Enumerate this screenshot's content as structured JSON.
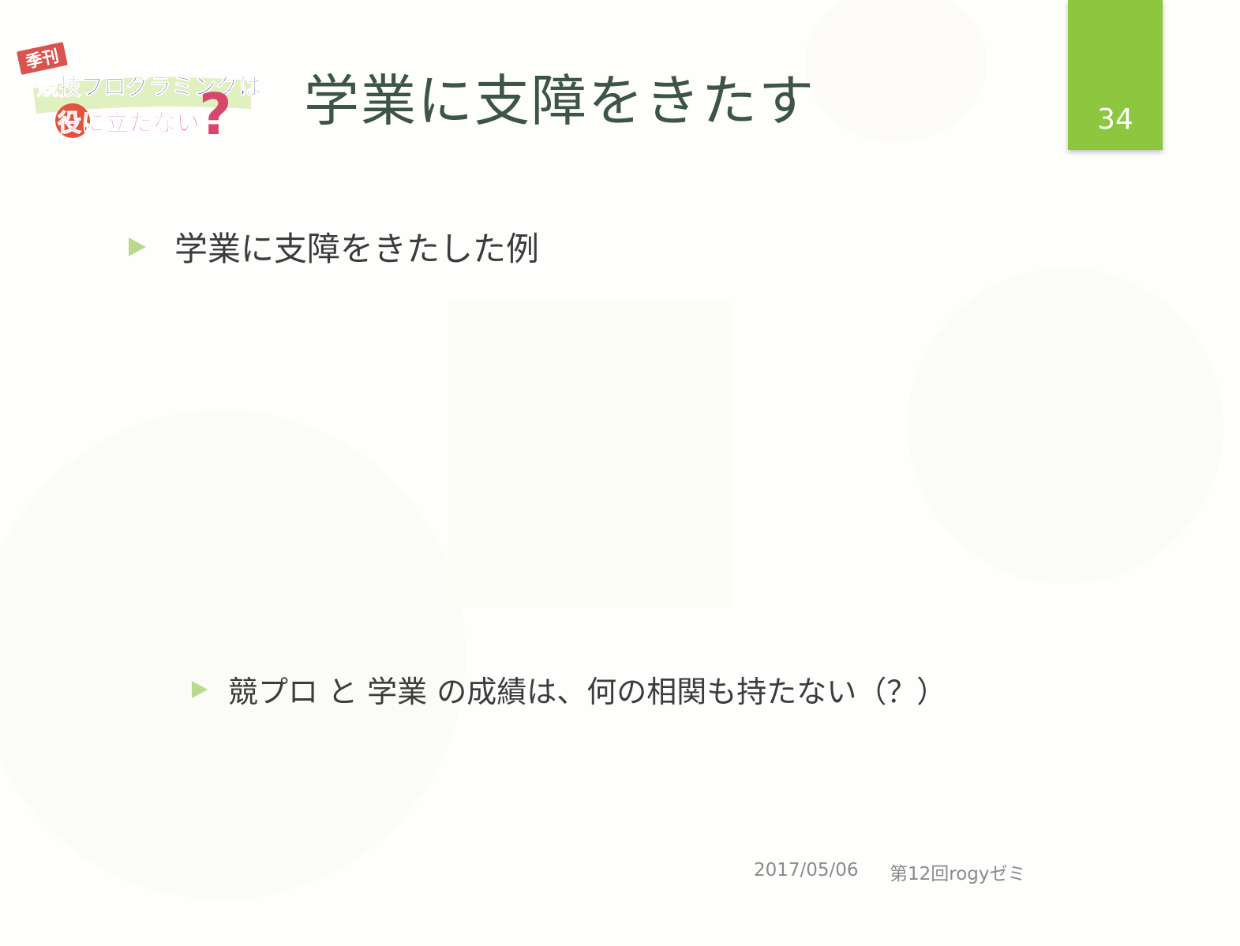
{
  "slide": {
    "logo": {
      "badge": "季刊",
      "line1": "競技プログラミングは",
      "line2": "役に立たない",
      "mark": "?"
    },
    "title": "学業に支障をきたす",
    "page_number": "34",
    "bullets": [
      {
        "text": "学業に支障をきたした例"
      },
      {
        "text": "競プロ と 学業 の成績は、何の相関も持たない（？）"
      }
    ],
    "footer": {
      "date": "2017/05/06",
      "event": "第12回rogyゼミ"
    }
  },
  "colors": {
    "accent": "#8dc63f",
    "bullet": "#b9da8c",
    "title": "#3d5448",
    "body_text": "#3c3c3c",
    "footer_text": "#8a8a8a"
  }
}
